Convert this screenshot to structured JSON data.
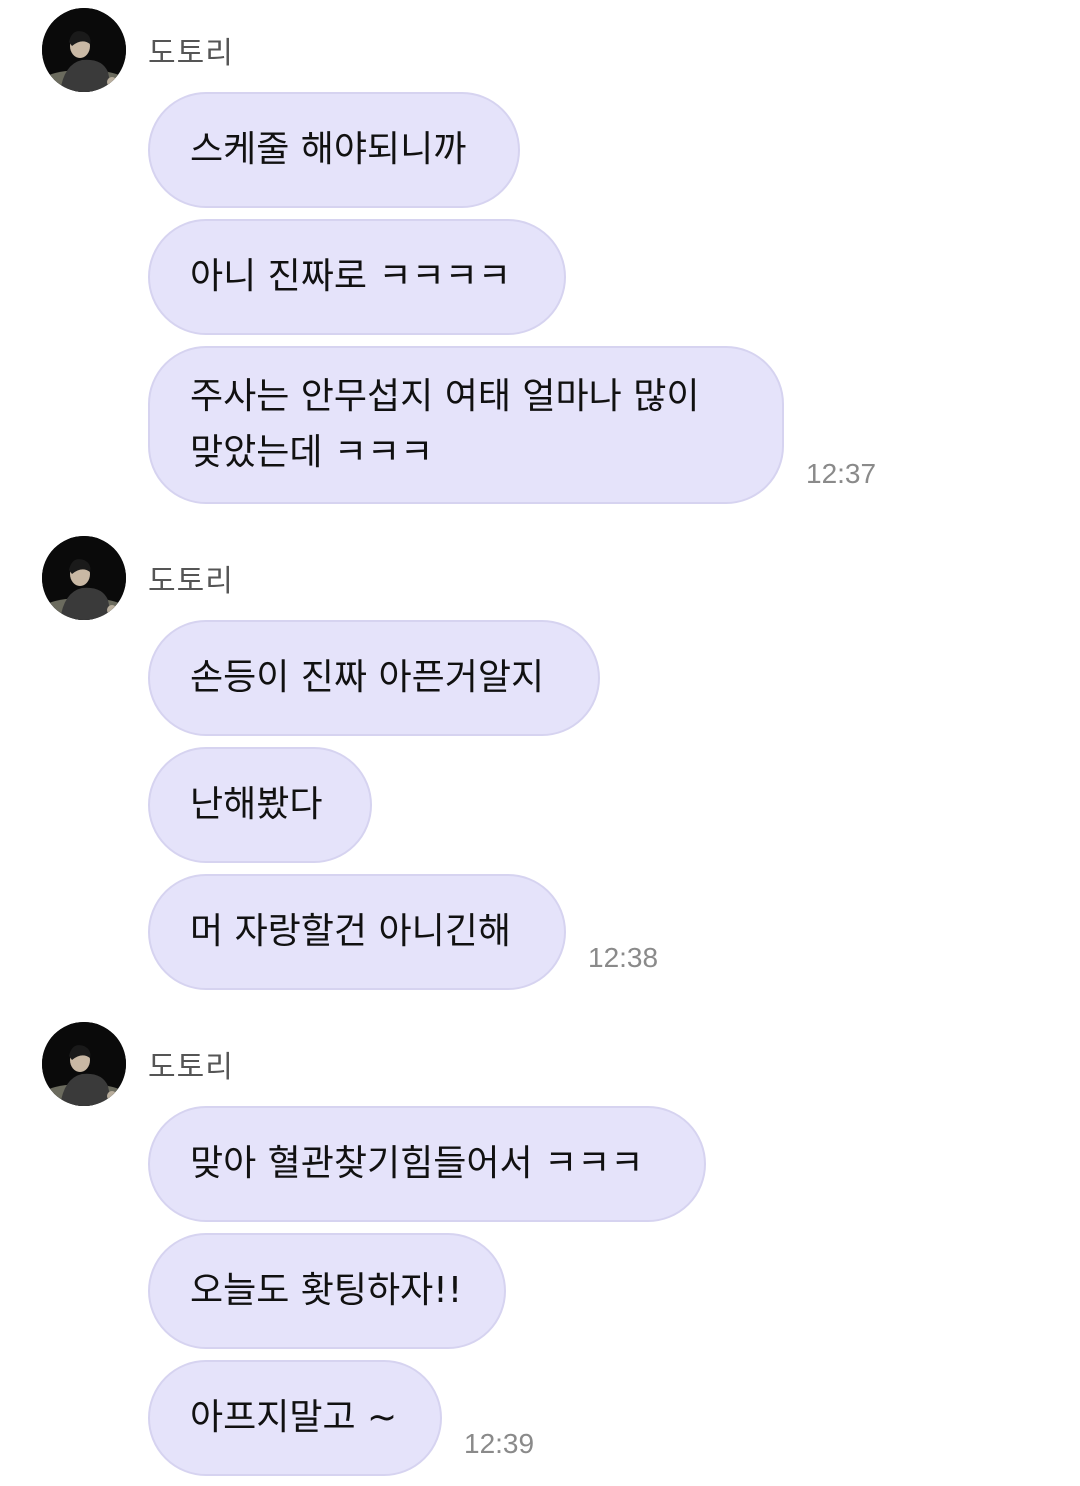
{
  "groups": [
    {
      "sender": "도토리",
      "messages": [
        "스케줄 해야되니까",
        "아니 진짜로 ㅋㅋㅋㅋ",
        "주사는 안무섭지 여태 얼마나 많이\n맞았는데 ㅋㅋㅋ"
      ],
      "time": "12:37"
    },
    {
      "sender": "도토리",
      "messages": [
        "손등이 진짜 아픈거알지",
        "난해봤다",
        "머 자랑할건 아니긴해"
      ],
      "time": "12:38"
    },
    {
      "sender": "도토리",
      "messages": [
        "맞아 혈관찾기힘들어서 ㅋㅋㅋ",
        "오늘도 홧팅하자!!",
        "아프지말고 ~"
      ],
      "time": "12:39"
    }
  ],
  "icons": {
    "avatar": "profile-photo-icon"
  },
  "colors": {
    "bubble": "#e5e3fa",
    "bubble_border": "#d6d3f0",
    "sender": "#555555",
    "time": "#8a8a8a"
  }
}
